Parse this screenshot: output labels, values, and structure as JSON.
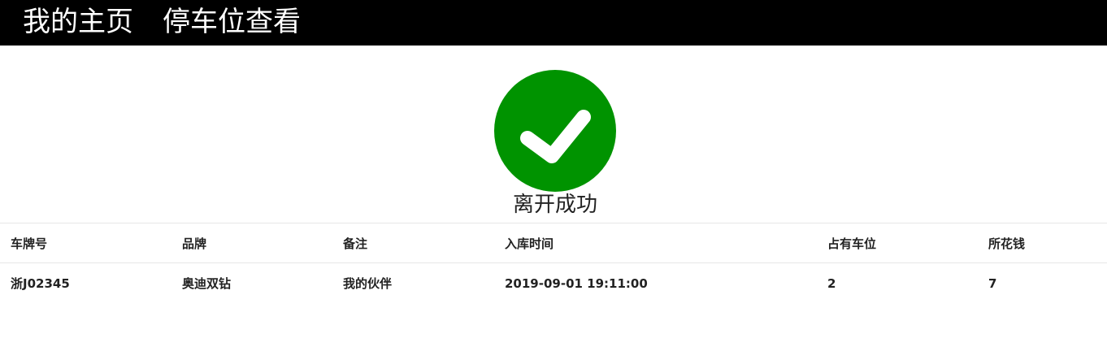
{
  "nav": {
    "home_label": "我的主页",
    "parking_label": "停车位查看"
  },
  "status": {
    "icon": "check-circle-icon",
    "icon_color": "#009300",
    "message": "离开成功"
  },
  "table": {
    "columns": [
      "车牌号",
      "品牌",
      "备注",
      "入库时间",
      "占有车位",
      "所花钱"
    ],
    "rows": [
      [
        "浙J02345",
        "奥迪双钻",
        "我的伙伴",
        "2019-09-01 19:11:00",
        "2",
        "7"
      ]
    ]
  }
}
